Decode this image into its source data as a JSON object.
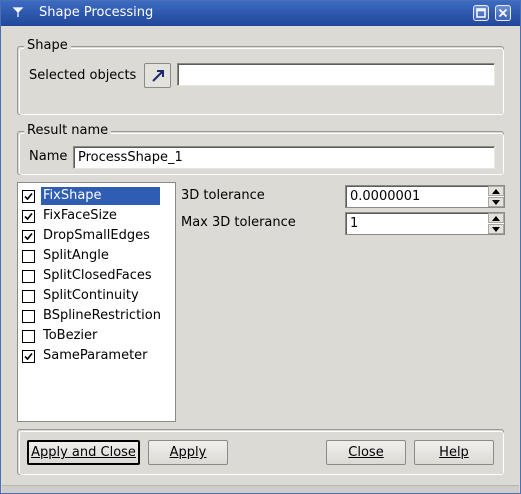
{
  "window": {
    "title": "Shape Processing"
  },
  "shape_group": {
    "title": "Shape",
    "selected_objects_label": "Selected objects",
    "selected_objects_value": ""
  },
  "result_group": {
    "title": "Result name",
    "name_label": "Name",
    "name_value": "ProcessShape_1"
  },
  "operators": [
    {
      "label": "FixShape",
      "checked": true,
      "selected": true
    },
    {
      "label": "FixFaceSize",
      "checked": true,
      "selected": false
    },
    {
      "label": "DropSmallEdges",
      "checked": true,
      "selected": false
    },
    {
      "label": "SplitAngle",
      "checked": false,
      "selected": false
    },
    {
      "label": "SplitClosedFaces",
      "checked": false,
      "selected": false
    },
    {
      "label": "SplitContinuity",
      "checked": false,
      "selected": false
    },
    {
      "label": "BSplineRestriction",
      "checked": false,
      "selected": false
    },
    {
      "label": "ToBezier",
      "checked": false,
      "selected": false
    },
    {
      "label": "SameParameter",
      "checked": true,
      "selected": false
    }
  ],
  "params": {
    "tolerance_label": "3D tolerance",
    "tolerance_value": "0.0000001",
    "max_tolerance_label": "Max 3D tolerance",
    "max_tolerance_value": "1"
  },
  "buttons": {
    "apply_and_close": "Apply and Close",
    "apply": "Apply",
    "close": "Close",
    "help": "Help"
  },
  "icons": {
    "title_icon": "pin-icon",
    "selection_arrow": "arrow-icon"
  },
  "colors": {
    "titlebar": "#2e58ad",
    "selection": "#2f5db3"
  }
}
